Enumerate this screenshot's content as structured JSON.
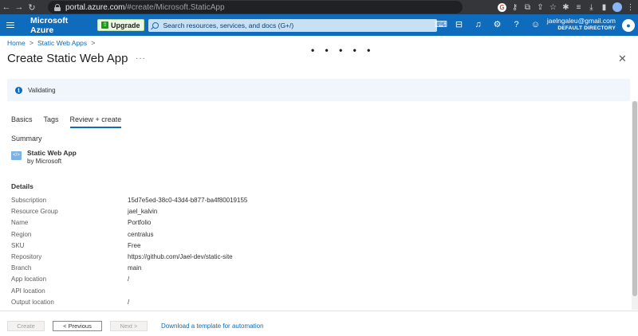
{
  "browser": {
    "url_host": "portal.azure.com",
    "url_path": "/#create/Microsoft.StaticApp"
  },
  "topbar": {
    "brand": "Microsoft Azure",
    "upgrade_label": "Upgrade",
    "search_placeholder": "Search resources, services, and docs (G+/)",
    "account_email": "jaelngaleu@gmail.com",
    "account_directory": "DEFAULT DIRECTORY"
  },
  "breadcrumb": {
    "home": "Home",
    "static_web_apps": "Static Web Apps",
    "sep": ">"
  },
  "page": {
    "title": "Create Static Web App",
    "more": "···",
    "loading": "• • • • •",
    "close": "✕"
  },
  "banner": {
    "validating": "Validating",
    "info": "i"
  },
  "tabs": [
    {
      "label": "Basics",
      "active": false
    },
    {
      "label": "Tags",
      "active": false
    },
    {
      "label": "Review + create",
      "active": true
    }
  ],
  "summary": {
    "label": "Summary",
    "product_name": "Static Web App",
    "vendor": "by Microsoft"
  },
  "details": {
    "title": "Details",
    "rows": [
      {
        "key": "Subscription",
        "value": "15d7e5ed-38c0-43d4-b877-ba4f80019155"
      },
      {
        "key": "Resource Group",
        "value": "jael_kalvin"
      },
      {
        "key": "Name",
        "value": "Portfolio"
      },
      {
        "key": "Region",
        "value": "centralus"
      },
      {
        "key": "SKU",
        "value": "Free"
      },
      {
        "key": "Repository",
        "value": "https://github.com/Jael-dev/static-site"
      },
      {
        "key": "Branch",
        "value": "main"
      },
      {
        "key": "App location",
        "value": "/"
      },
      {
        "key": "API location",
        "value": ""
      },
      {
        "key": "Output location",
        "value": "/"
      }
    ]
  },
  "footer": {
    "create": "Create",
    "previous": "< Previous",
    "next": "Next >",
    "template_link": "Download a template for automation"
  },
  "colors": {
    "azure_blue": "#0f6cbd",
    "chrome_dark": "#35363a",
    "banner_bg": "#f0f6fc"
  }
}
